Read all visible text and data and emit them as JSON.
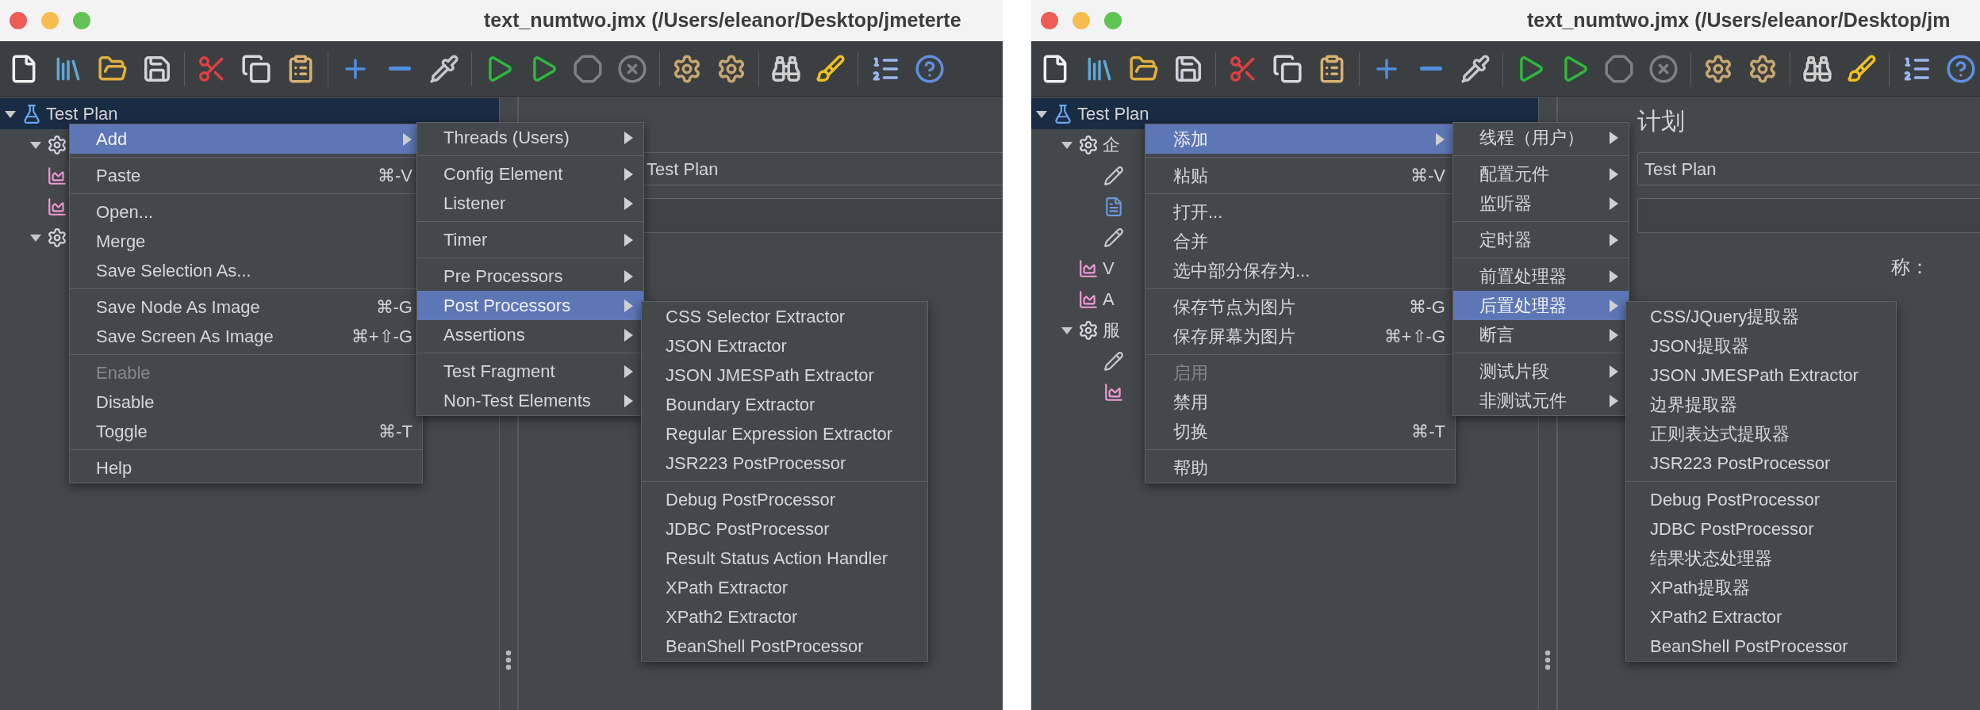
{
  "windows": [
    {
      "title": "text_numtwo.jmx (/Users/eleanor/Desktop/jmeterte",
      "tree": [
        {
          "label": "Test Plan",
          "kind": "test-plan",
          "selected": true,
          "expanded": true,
          "children": [
            {
              "kind": "thread-group",
              "selected": false,
              "expanded": true
            },
            {
              "kind": "listener",
              "selected": false
            },
            {
              "kind": "listener",
              "selected": false
            },
            {
              "kind": "thread-group",
              "selected": false,
              "expanded": true
            }
          ]
        }
      ],
      "panel": {
        "name_field": {
          "value": "Test Plan"
        }
      },
      "menus": [
        {
          "items": [
            {
              "kind": "submenu",
              "label": "Add",
              "selected": true,
              "disabled": false
            },
            {
              "kind": "separator"
            },
            {
              "kind": "item",
              "label": "Paste",
              "shortcut": "⌘-V",
              "selected": false,
              "disabled": false
            },
            {
              "kind": "separator"
            },
            {
              "kind": "item",
              "label": "Open...",
              "selected": false,
              "disabled": false
            },
            {
              "kind": "item",
              "label": "Merge",
              "selected": false,
              "disabled": false
            },
            {
              "kind": "item",
              "label": "Save Selection As...",
              "selected": false,
              "disabled": false
            },
            {
              "kind": "separator"
            },
            {
              "kind": "item",
              "label": "Save Node As Image",
              "shortcut": "⌘-G",
              "selected": false,
              "disabled": false
            },
            {
              "kind": "item",
              "label": "Save Screen As Image",
              "shortcut": "⌘+⇧-G",
              "selected": false,
              "disabled": false
            },
            {
              "kind": "separator"
            },
            {
              "kind": "item",
              "label": "Enable",
              "selected": false,
              "disabled": true
            },
            {
              "kind": "item",
              "label": "Disable",
              "selected": false,
              "disabled": false
            },
            {
              "kind": "item",
              "label": "Toggle",
              "shortcut": "⌘-T",
              "selected": false,
              "disabled": false
            },
            {
              "kind": "separator"
            },
            {
              "kind": "item",
              "label": "Help",
              "selected": false,
              "disabled": false
            }
          ]
        },
        {
          "items": [
            {
              "kind": "submenu",
              "label": "Threads (Users)",
              "selected": false
            },
            {
              "kind": "separator"
            },
            {
              "kind": "submenu",
              "label": "Config Element",
              "selected": false
            },
            {
              "kind": "submenu",
              "label": "Listener",
              "selected": false
            },
            {
              "kind": "separator"
            },
            {
              "kind": "submenu",
              "label": "Timer",
              "selected": false
            },
            {
              "kind": "separator"
            },
            {
              "kind": "submenu",
              "label": "Pre Processors",
              "selected": false
            },
            {
              "kind": "submenu",
              "label": "Post Processors",
              "selected": true
            },
            {
              "kind": "submenu",
              "label": "Assertions",
              "selected": false
            },
            {
              "kind": "separator"
            },
            {
              "kind": "submenu",
              "label": "Test Fragment",
              "selected": false
            },
            {
              "kind": "submenu",
              "label": "Non-Test Elements",
              "selected": false
            }
          ]
        },
        {
          "items": [
            {
              "kind": "item",
              "label": "CSS Selector Extractor",
              "selected": false
            },
            {
              "kind": "item",
              "label": "JSON Extractor",
              "selected": false
            },
            {
              "kind": "item",
              "label": "JSON JMESPath Extractor",
              "selected": false
            },
            {
              "kind": "item",
              "label": "Boundary Extractor",
              "selected": false
            },
            {
              "kind": "item",
              "label": "Regular Expression Extractor",
              "selected": false
            },
            {
              "kind": "item",
              "label": "JSR223 PostProcessor",
              "selected": false
            },
            {
              "kind": "separator"
            },
            {
              "kind": "item",
              "label": "Debug PostProcessor",
              "selected": false
            },
            {
              "kind": "item",
              "label": "JDBC PostProcessor",
              "selected": false
            },
            {
              "kind": "item",
              "label": "Result Status Action Handler",
              "selected": false
            },
            {
              "kind": "item",
              "label": "XPath Extractor",
              "selected": false
            },
            {
              "kind": "item",
              "label": "XPath2 Extractor",
              "selected": false
            },
            {
              "kind": "item",
              "label": "BeanShell PostProcessor",
              "selected": false
            }
          ]
        }
      ]
    },
    {
      "title": "text_numtwo.jmx (/Users/eleanor/Desktop/jm",
      "tree": [
        {
          "label": "Test Plan",
          "kind": "test-plan",
          "selected": true,
          "expanded": true,
          "children": [
            {
              "label": "企",
              "kind": "thread-group",
              "selected": false,
              "expanded": true,
              "children": [
                {
                  "kind": "sampler",
                  "selected": false
                },
                {
                  "kind": "config",
                  "selected": false
                },
                {
                  "kind": "sampler",
                  "selected": false
                }
              ]
            },
            {
              "label": "V",
              "kind": "listener",
              "selected": false
            },
            {
              "label": "A",
              "kind": "listener",
              "selected": false
            },
            {
              "label": "服",
              "kind": "thread-group",
              "selected": false,
              "expanded": true,
              "children": [
                {
                  "kind": "sampler",
                  "selected": false
                },
                {
                  "kind": "listener",
                  "selected": false
                }
              ]
            }
          ]
        }
      ],
      "panel": {
        "heading": "计划",
        "name_field": {
          "value": "Test Plan"
        },
        "field_label": "称："
      },
      "menus": [
        {
          "items": [
            {
              "kind": "submenu",
              "label": "添加",
              "selected": true,
              "disabled": false
            },
            {
              "kind": "separator"
            },
            {
              "kind": "item",
              "label": "粘贴",
              "shortcut": "⌘-V",
              "selected": false,
              "disabled": false
            },
            {
              "kind": "separator"
            },
            {
              "kind": "item",
              "label": "打开...",
              "selected": false,
              "disabled": false
            },
            {
              "kind": "item",
              "label": "合并",
              "selected": false,
              "disabled": false
            },
            {
              "kind": "item",
              "label": "选中部分保存为...",
              "selected": false,
              "disabled": false
            },
            {
              "kind": "separator"
            },
            {
              "kind": "item",
              "label": "保存节点为图片",
              "shortcut": "⌘-G",
              "selected": false,
              "disabled": false
            },
            {
              "kind": "item",
              "label": "保存屏幕为图片",
              "shortcut": "⌘+⇧-G",
              "selected": false,
              "disabled": false
            },
            {
              "kind": "separator"
            },
            {
              "kind": "item",
              "label": "启用",
              "selected": false,
              "disabled": true
            },
            {
              "kind": "item",
              "label": "禁用",
              "selected": false,
              "disabled": false
            },
            {
              "kind": "item",
              "label": "切换",
              "shortcut": "⌘-T",
              "selected": false,
              "disabled": false
            },
            {
              "kind": "separator"
            },
            {
              "kind": "item",
              "label": "帮助",
              "selected": false,
              "disabled": false
            }
          ]
        },
        {
          "items": [
            {
              "kind": "submenu",
              "label": "线程（用户）",
              "selected": false
            },
            {
              "kind": "separator"
            },
            {
              "kind": "submenu",
              "label": "配置元件",
              "selected": false
            },
            {
              "kind": "submenu",
              "label": "监听器",
              "selected": false
            },
            {
              "kind": "separator"
            },
            {
              "kind": "submenu",
              "label": "定时器",
              "selected": false
            },
            {
              "kind": "separator"
            },
            {
              "kind": "submenu",
              "label": "前置处理器",
              "selected": false
            },
            {
              "kind": "submenu",
              "label": "后置处理器",
              "selected": true
            },
            {
              "kind": "submenu",
              "label": "断言",
              "selected": false
            },
            {
              "kind": "separator"
            },
            {
              "kind": "submenu",
              "label": "测试片段",
              "selected": false
            },
            {
              "kind": "submenu",
              "label": "非测试元件",
              "selected": false
            }
          ]
        },
        {
          "items": [
            {
              "kind": "item",
              "label": "CSS/JQuery提取器",
              "selected": false
            },
            {
              "kind": "item",
              "label": "JSON提取器",
              "selected": false
            },
            {
              "kind": "item",
              "label": "JSON JMESPath Extractor",
              "selected": false
            },
            {
              "kind": "item",
              "label": "边界提取器",
              "selected": false
            },
            {
              "kind": "item",
              "label": "正则表达式提取器",
              "selected": false
            },
            {
              "kind": "item",
              "label": "JSR223 PostProcessor",
              "selected": false
            },
            {
              "kind": "separator"
            },
            {
              "kind": "item",
              "label": "Debug PostProcessor",
              "selected": false
            },
            {
              "kind": "item",
              "label": "JDBC PostProcessor",
              "selected": false
            },
            {
              "kind": "item",
              "label": "结果状态处理器",
              "selected": false
            },
            {
              "kind": "item",
              "label": "XPath提取器",
              "selected": false
            },
            {
              "kind": "item",
              "label": "XPath2 Extractor",
              "selected": false
            },
            {
              "kind": "item",
              "label": "BeanShell PostProcessor",
              "selected": false
            }
          ]
        }
      ]
    }
  ]
}
